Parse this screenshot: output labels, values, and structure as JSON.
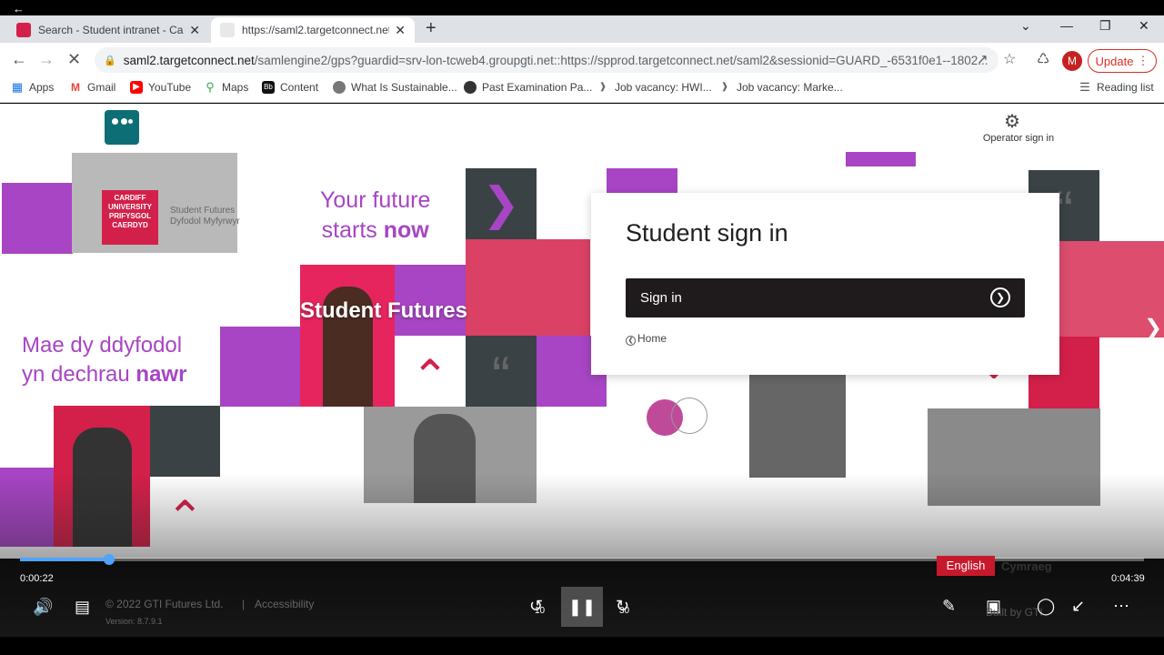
{
  "browser": {
    "tabs": [
      {
        "title": "Search - Student intranet - Cardi",
        "favicon_color": "#d3204a"
      },
      {
        "title": "https://saml2.targetconnect.net/",
        "favicon_color": "#dddddd"
      }
    ],
    "url_host": "saml2.targetconnect.net",
    "url_path": "/samlengine2/gps?guardid=srv-lon-tcweb4.groupgti.net::https://spprod.targetconnect.net/saml2&sessionid=GUARD_-6531f0e1--1802...",
    "profile_initial": "M",
    "update_label": "Update",
    "bookmarks": [
      {
        "label": "Apps",
        "icon": "apps-grid-icon"
      },
      {
        "label": "Gmail",
        "icon": "gmail-icon"
      },
      {
        "label": "YouTube",
        "icon": "youtube-icon"
      },
      {
        "label": "Maps",
        "icon": "maps-icon"
      },
      {
        "label": "Content",
        "icon": "blackboard-icon"
      },
      {
        "label": "What Is Sustainable...",
        "icon": "site-icon"
      },
      {
        "label": "Past Examination Pa...",
        "icon": "site-icon"
      },
      {
        "label": "Job vacancy: HWI...",
        "icon": "site-icon"
      },
      {
        "label": "Job vacancy: Marke...",
        "icon": "site-icon"
      }
    ],
    "reading_list": "Reading list"
  },
  "page": {
    "operator_sign_in": "Operator sign in",
    "tagline_en_line1": "Your future",
    "tagline_en_line2a": "starts ",
    "tagline_en_line2b": "now",
    "tagline_cy_line1": "Mae dy ddyfodol",
    "tagline_cy_line2a": "yn dechrau ",
    "tagline_cy_line2b": "nawr",
    "brand_text": "Student Futures",
    "cardiff_logo_line1": "CARDIFF",
    "cardiff_logo_line2": "UNIVERSITY",
    "cardiff_logo_line3": "PRIFYSGOL",
    "cardiff_logo_line4": "CAERDYD",
    "cardiff_sub1": "Student Futures",
    "cardiff_sub2": "Dyfodol Myfyrwyr",
    "card": {
      "title": "Student sign in",
      "button_label": "Sign in",
      "home_link": "Home"
    }
  },
  "video": {
    "current_time": "0:00:22",
    "total_time": "0:04:39",
    "progress": 0.079,
    "lang_english": "English",
    "lang_cymraeg": "Cymraeg",
    "rewind_seconds": "10",
    "forward_seconds": "30",
    "footer_copyright": "© 2022 GTI Futures Ltd.",
    "footer_accessibility": "Accessibility",
    "footer_version": "Version: 8.7.9.1",
    "built_by": "Built by GTI"
  }
}
